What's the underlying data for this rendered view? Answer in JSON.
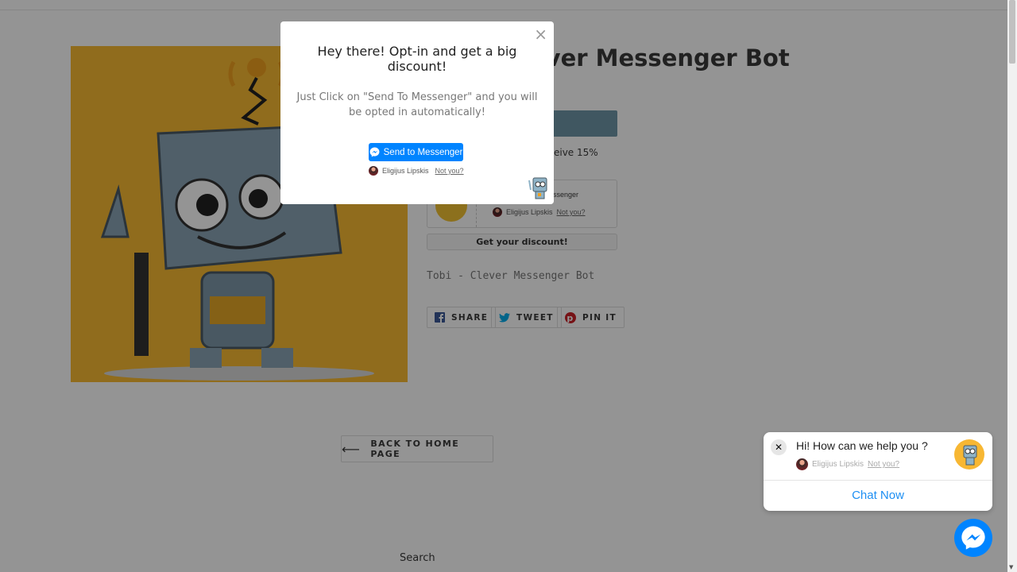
{
  "product": {
    "title": "Tobi - Clever Messenger Bot",
    "offer_fragment": "eceive 15%",
    "widget_fragment": "essenger",
    "widget_user": "Eligijus Lipskis",
    "widget_not_you": "Not you?",
    "get_discount": "Get your discount!",
    "description": "Tobi - Clever Messenger Bot",
    "share": "SHARE",
    "tweet": "TWEET",
    "pin": "PIN IT"
  },
  "back_link": "BACK TO HOME PAGE",
  "back_arrow": "⟵",
  "footer": {
    "search": "Search"
  },
  "popup": {
    "close": "×",
    "title": "Hey there! Opt-in and get a big discount!",
    "text": "Just Click on \"Send To Messenger\" and you will be opted in automatically!",
    "send_button": "Send to Messenger",
    "user": "Eligijus Lipskis",
    "not_you": "Not you?"
  },
  "chat_widget": {
    "close": "✕",
    "question": "Hi! How can we help you ?",
    "user": "Eligijus Lipskis",
    "not_you": "Not you?",
    "cta": "Chat Now"
  },
  "colors": {
    "messenger": "#0084ff",
    "product_bg": "#f9bb32",
    "add_button": "#6e96a8",
    "overlay": "rgba(0,0,0,0.42)"
  }
}
